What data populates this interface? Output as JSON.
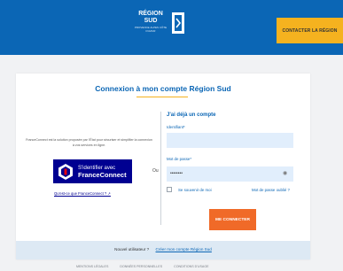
{
  "header": {
    "logo_line1": "RÉGION",
    "logo_line2": "SUD",
    "logo_small": "PROVENCE ALPES CÔTE D'AZUR",
    "contact_label": "CONTACTER LA RÉGION",
    "brand_color": "#0b66b5",
    "accent_color": "#f5b21f"
  },
  "login": {
    "title": "Connexion à mon compte Région Sud",
    "franceconnect": {
      "description": "FranceConnect est la solution proposée par l'État pour sécuriser et simplifier la connexion à vos services en ligne.",
      "button_line1": "S'identifier avec",
      "button_line2": "FranceConnect",
      "info_link": "Qu'est-ce que FranceConnect ? ↗",
      "button_color": "#000091"
    },
    "separator": "Ou",
    "form": {
      "heading": "J'ai déjà un compte",
      "identifier_label": "Identifiant*",
      "identifier_value": "",
      "password_label": "Mot de passe*",
      "password_value": "••••••••",
      "password_icon": "eye-icon",
      "remember_label": "Se souvenir de moi",
      "remember_checked": false,
      "forgot_link": "Mot de passe oublié ?",
      "submit_label": "ME CONNECTER",
      "submit_color": "#f06a28"
    },
    "signup": {
      "text": "Nouvel utilisateur ?",
      "link": "Créer mon compte Région Sud"
    }
  },
  "footer": {
    "links": [
      "MENTIONS LÉGALES",
      "DONNÉES PERSONNELLES",
      "CONDITIONS D'USAGE"
    ]
  }
}
